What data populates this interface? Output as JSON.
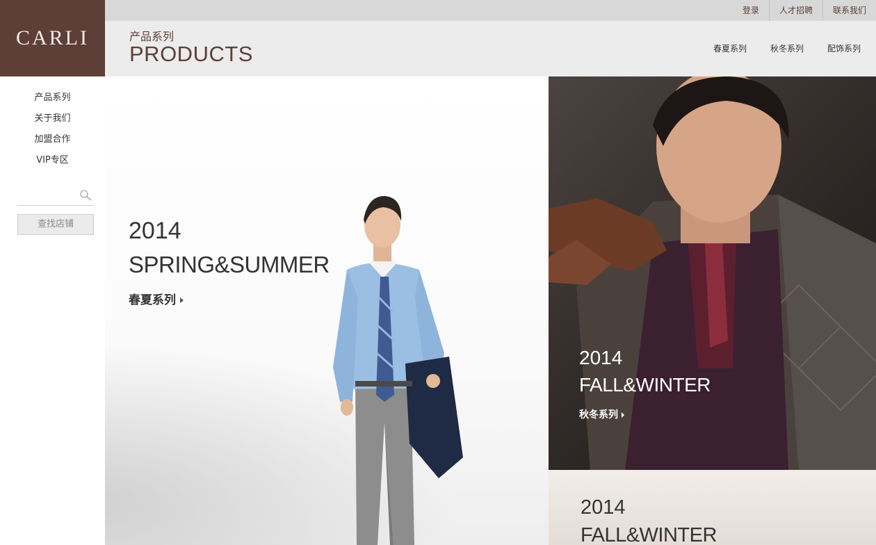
{
  "brand": {
    "logo_text": "CARLI",
    "color": "#5e3f37"
  },
  "top_links": [
    "登录",
    "人才招聘",
    "联系我们"
  ],
  "header": {
    "cn_title": "产品系列",
    "en_title": "PRODUCTS",
    "subnav": [
      "春夏系列",
      "秋冬系列",
      "配饰系列"
    ]
  },
  "sidebar": {
    "items": [
      "产品系列",
      "关于我们",
      "加盟合作",
      "VIP专区"
    ],
    "search": {
      "placeholder": "",
      "icon": "search-icon"
    },
    "store_button": "查找店铺"
  },
  "panels": {
    "spring_summer": {
      "year": "2014",
      "season": "SPRING&SUMMER",
      "link": "春夏系列"
    },
    "fall_winter": {
      "year": "2014",
      "season": "FALL&WINTER",
      "link": "秋冬系列"
    },
    "accessories": {
      "year": "2014",
      "season": "FALL&WINTER"
    }
  }
}
